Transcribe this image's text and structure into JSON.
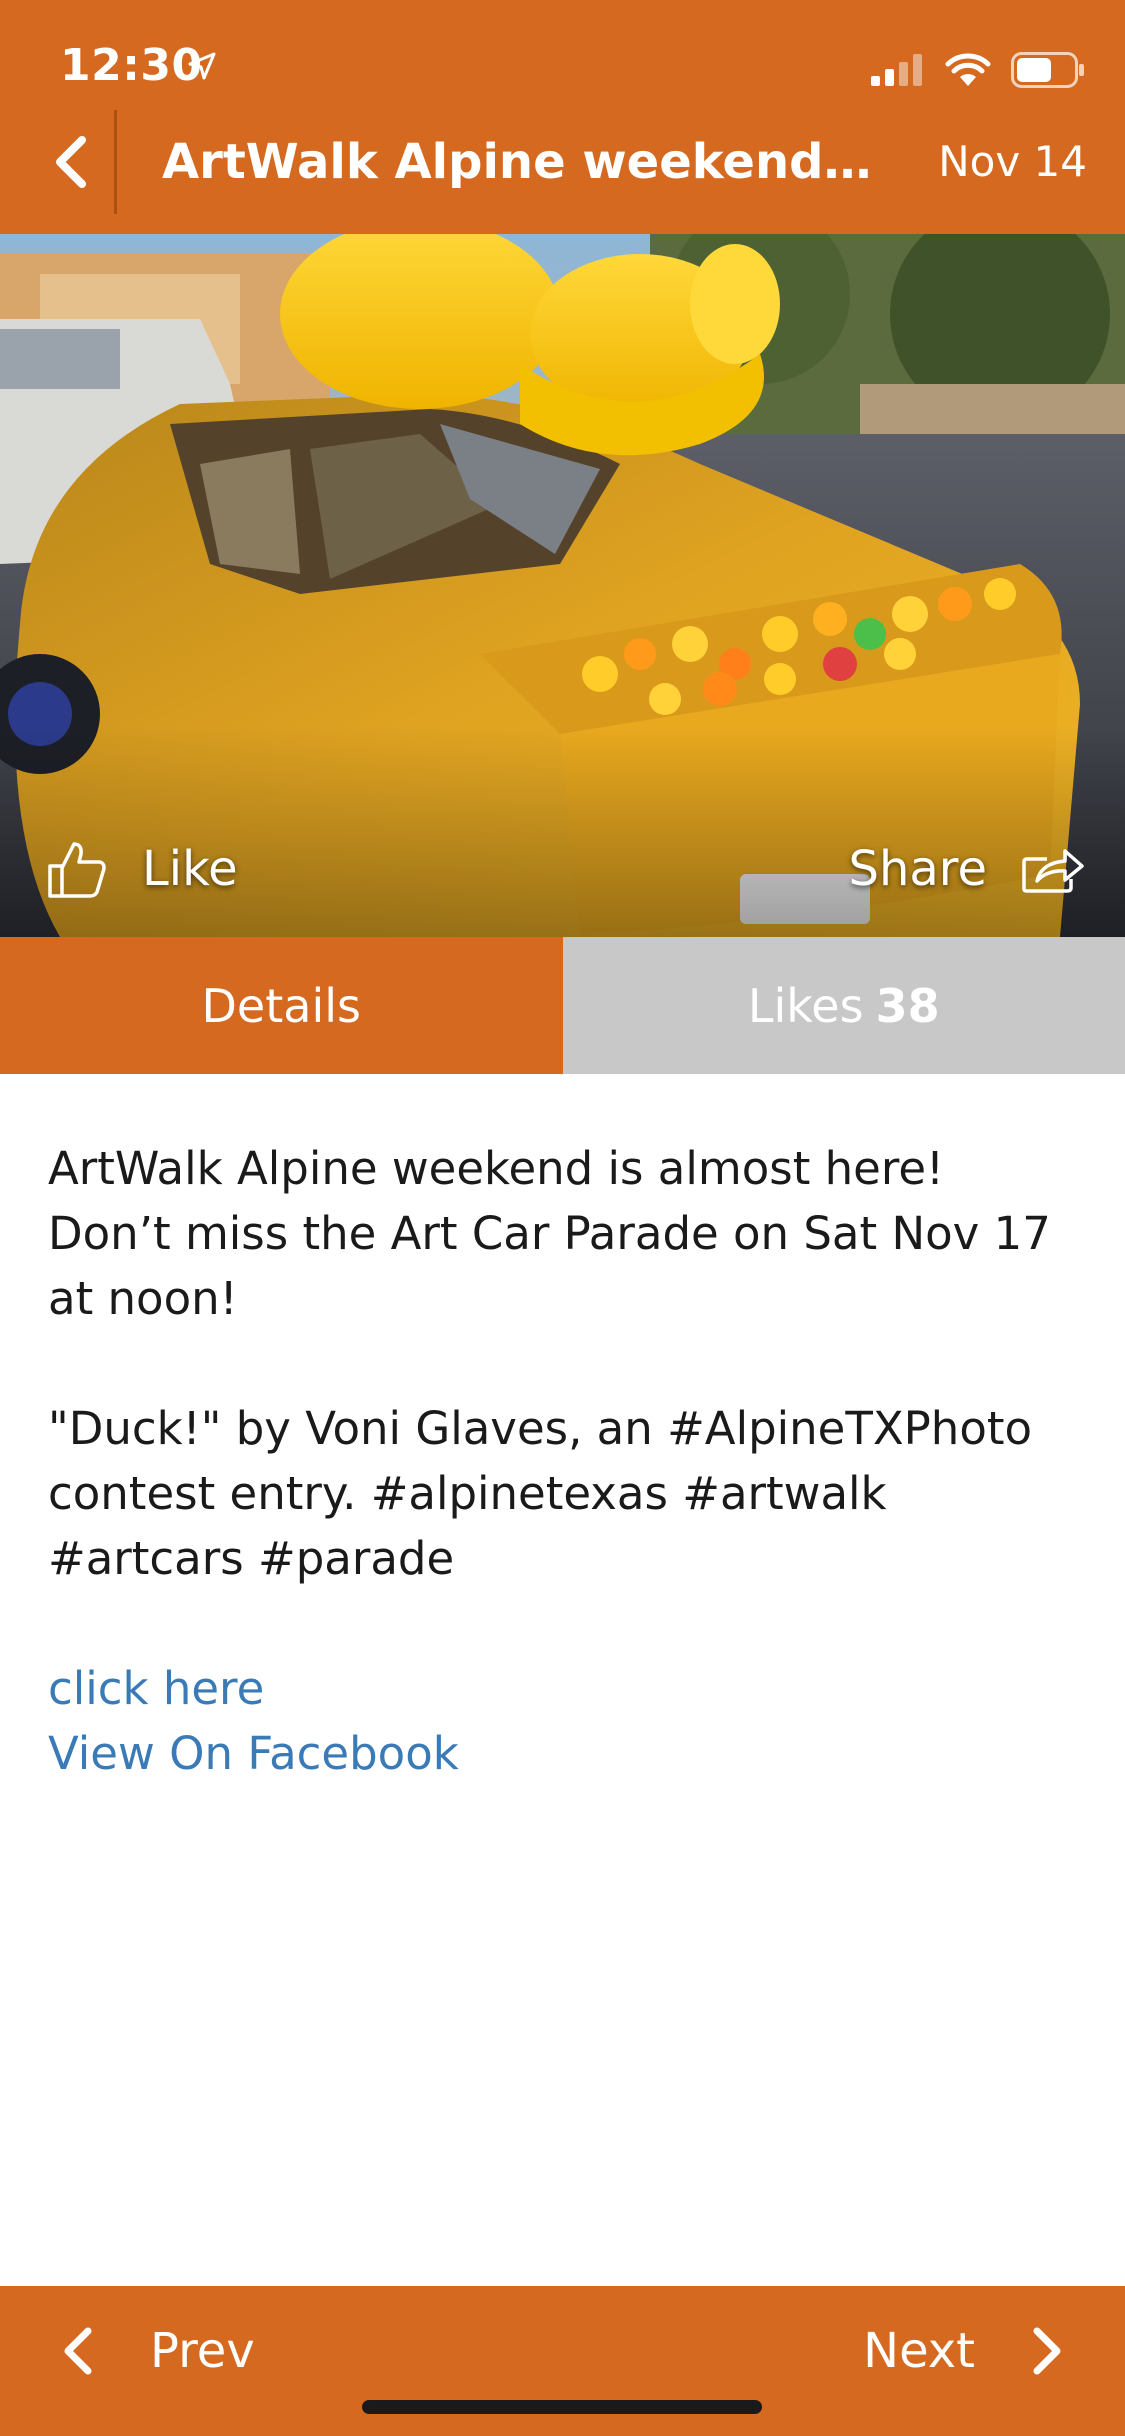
{
  "status_bar": {
    "time": "12:30"
  },
  "nav": {
    "title": "ArtWalk Alpine weekend is al...",
    "date": "Nov 14"
  },
  "hero": {
    "like_label": "Like",
    "share_label": "Share"
  },
  "tabs": {
    "details_label": "Details",
    "likes_label": "Likes",
    "likes_count": "38"
  },
  "post": {
    "paragraph_1": "ArtWalk Alpine weekend is almost here! Don’t miss the Art Car Parade on Sat Nov 17 at noon!",
    "paragraph_2": "\"Duck!\" by Voni Glaves, an #AlpineTXPhoto contest entry. #alpinetexas #artwalk #artcars #parade",
    "link_1": "click here",
    "link_2": "View On Facebook"
  },
  "footer": {
    "prev_label": "Prev",
    "next_label": "Next"
  },
  "colors": {
    "accent": "#d5691f",
    "inactive_tab": "#c8c8c8",
    "link": "#3a7bb7"
  },
  "icons": {
    "status": [
      "location-arrow-icon",
      "signal-icon",
      "wifi-icon",
      "battery-icon"
    ],
    "nav": [
      "back-chevron-icon"
    ],
    "hero": [
      "thumbs-up-icon",
      "share-icon"
    ],
    "footer": [
      "prev-chevron-icon",
      "next-chevron-icon"
    ]
  }
}
